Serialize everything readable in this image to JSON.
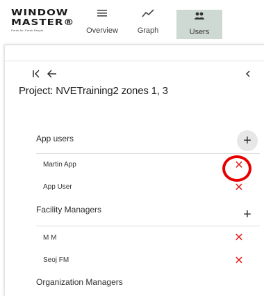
{
  "logo": {
    "line1": "WINDOW",
    "line2": "MASTER®",
    "tagline": "Fresh Air. Fresh People."
  },
  "nav": {
    "overview_label": "Overview",
    "graph_label": "Graph",
    "users_label": "Users",
    "active": "Users"
  },
  "panel": {
    "first_icon": "first-page-icon",
    "back_icon": "arrow-left-icon",
    "collapse_icon": "chevron-left-icon",
    "project_title": "Project: NVETraining2 zones 1, 3"
  },
  "sections": {
    "app_users": {
      "header": "App users",
      "items": [
        "Martin App",
        "App User"
      ]
    },
    "facility_managers": {
      "header": "Facility Managers",
      "items": [
        "M M",
        "Seoj FM"
      ]
    },
    "organization_managers": {
      "header": "Organization Managers"
    }
  },
  "colors": {
    "remove": "#e02020",
    "active_tab": "#cfd9d3",
    "highlight": "#e60000"
  }
}
